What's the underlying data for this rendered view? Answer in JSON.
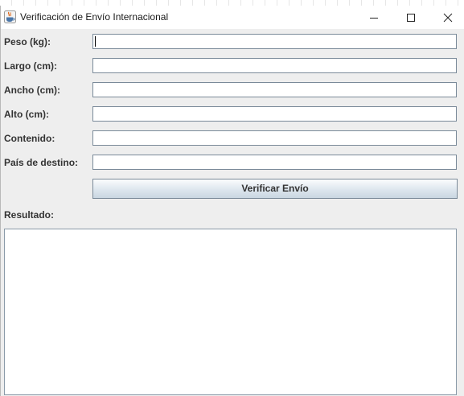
{
  "window": {
    "title": "Verificación de Envío Internacional",
    "app_icon": "java-cup-icon",
    "controls": [
      "minimize-icon",
      "maximize-icon",
      "close-icon"
    ]
  },
  "form": {
    "fields": [
      {
        "label": "Peso (kg):",
        "value": ""
      },
      {
        "label": "Largo (cm):",
        "value": ""
      },
      {
        "label": "Ancho (cm):",
        "value": ""
      },
      {
        "label": "Alto (cm):",
        "value": ""
      },
      {
        "label": "Contenido:",
        "value": ""
      },
      {
        "label": "País de destino:",
        "value": ""
      }
    ],
    "submit_label": "Verificar Envío"
  },
  "result": {
    "label": "Resultado:",
    "text": ""
  },
  "colors": {
    "window_background": "#eeeeee",
    "field_border": "#7a8a99",
    "button_gradient_top": "#fbfcfd",
    "button_gradient_bottom": "#c9d6e1"
  }
}
